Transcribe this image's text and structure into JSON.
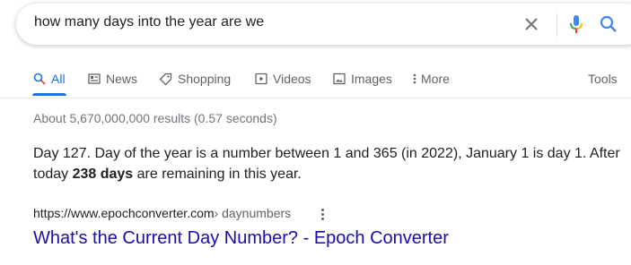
{
  "search": {
    "query": "how many days into the year are we"
  },
  "tabs": [
    {
      "label": "All",
      "icon": "search-icon",
      "active": true
    },
    {
      "label": "News",
      "icon": "news-icon"
    },
    {
      "label": "Shopping",
      "icon": "tag-icon"
    },
    {
      "label": "Videos",
      "icon": "video-icon"
    },
    {
      "label": "Images",
      "icon": "image-icon"
    },
    {
      "label": "More",
      "icon": "more-vert-icon"
    }
  ],
  "tools_label": "Tools",
  "result_stats": "About 5,670,000,000 results (0.57 seconds)",
  "snippet": {
    "line1": "Day 127. Day of the year is a number between 1 and 365 (in 2022), January 1 is day 1. After",
    "line2_pre": "today ",
    "line2_bold": "238 days",
    "line2_post": " are remaining in this year."
  },
  "result": {
    "url": "https://www.epochconverter.com",
    "path": " › daynumbers",
    "title": "What's the Current Day Number? - Epoch Converter"
  },
  "colors": {
    "accent": "#1a73e8",
    "link": "#1a0dab",
    "muted": "#70757a"
  }
}
